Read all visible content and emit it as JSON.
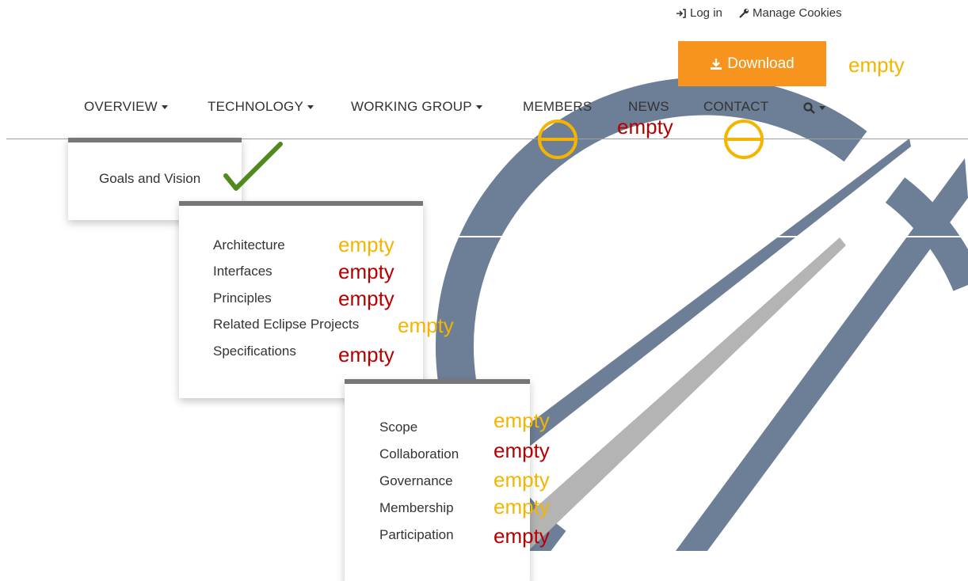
{
  "topbar": {
    "login_label": "Log in",
    "cookies_label": "Manage Cookies"
  },
  "download": {
    "label": "Download",
    "annotation": "empty"
  },
  "nav": {
    "items": [
      {
        "label": "OVERVIEW",
        "has_caret": true
      },
      {
        "label": "TECHNOLOGY",
        "has_caret": true
      },
      {
        "label": "WORKING GROUP",
        "has_caret": true
      },
      {
        "label": "MEMBERS",
        "has_caret": false
      },
      {
        "label": "NEWS",
        "has_caret": false
      },
      {
        "label": "CONTACT",
        "has_caret": false
      }
    ],
    "news_annotation": "empty"
  },
  "dropdowns": {
    "overview": {
      "items": [
        "Goals and Vision"
      ]
    },
    "technology": {
      "items": [
        "Architecture",
        "Interfaces",
        "Principles",
        "Related Eclipse Projects",
        "Specifications"
      ],
      "annotations": [
        "empty",
        "empty",
        "empty",
        "empty",
        "empty"
      ]
    },
    "working_group": {
      "items": [
        "Scope",
        "Collaboration",
        "Governance",
        "Membership",
        "Participation"
      ],
      "annotations": [
        "empty",
        "empty",
        "empty",
        "empty",
        "empty"
      ]
    }
  },
  "colors": {
    "accent_orange": "#f7941d",
    "annotation_yellow": "#f4b400",
    "annotation_red": "#b80000",
    "check_green": "#4e8a1e",
    "logo_slate": "#6d7f97",
    "logo_gray": "#b4b4b4"
  },
  "icons": [
    "login-icon",
    "wrench-icon",
    "download-icon",
    "search-icon",
    "checkmark-icon",
    "circle-strike-icon"
  ]
}
